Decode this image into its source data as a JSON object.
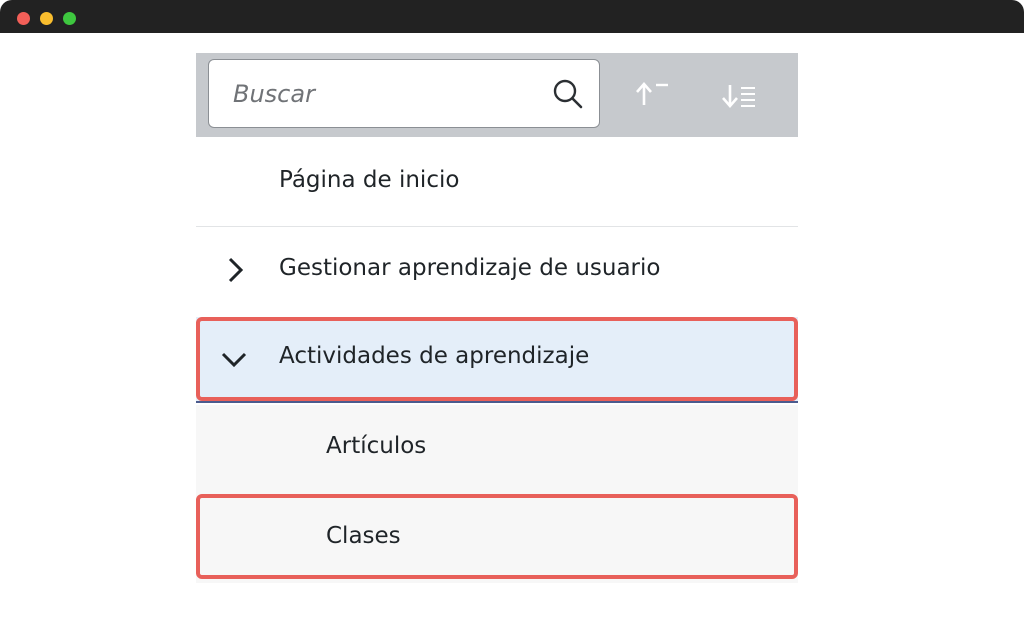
{
  "window": {
    "controls": [
      "close",
      "minimize",
      "maximize"
    ]
  },
  "toolbar": {
    "search": {
      "placeholder": "Buscar",
      "value": "",
      "icon": "search-icon"
    },
    "sort_ascending_icon": "sort-ascending-icon",
    "sort_descending_icon": "sort-descending-icon"
  },
  "nav": {
    "items": [
      {
        "label": "Página de inicio",
        "expandable": false
      },
      {
        "label": "Gestionar aprendizaje de usuario",
        "expandable": true,
        "expanded": false
      },
      {
        "label": "Actividades de aprendizaje",
        "expandable": true,
        "expanded": true,
        "selected": true,
        "children": [
          {
            "label": "Artículos"
          },
          {
            "label": "Clases"
          }
        ]
      }
    ]
  },
  "annotations": {
    "highlight_color": "#e8605a",
    "highlighted_items": [
      "Actividades de aprendizaje",
      "Clases"
    ]
  },
  "colors": {
    "selected_row_bg": "#e4eef9",
    "toolbar_bg": "#c6c9cd",
    "child_row_bg": "#f7f7f7"
  }
}
